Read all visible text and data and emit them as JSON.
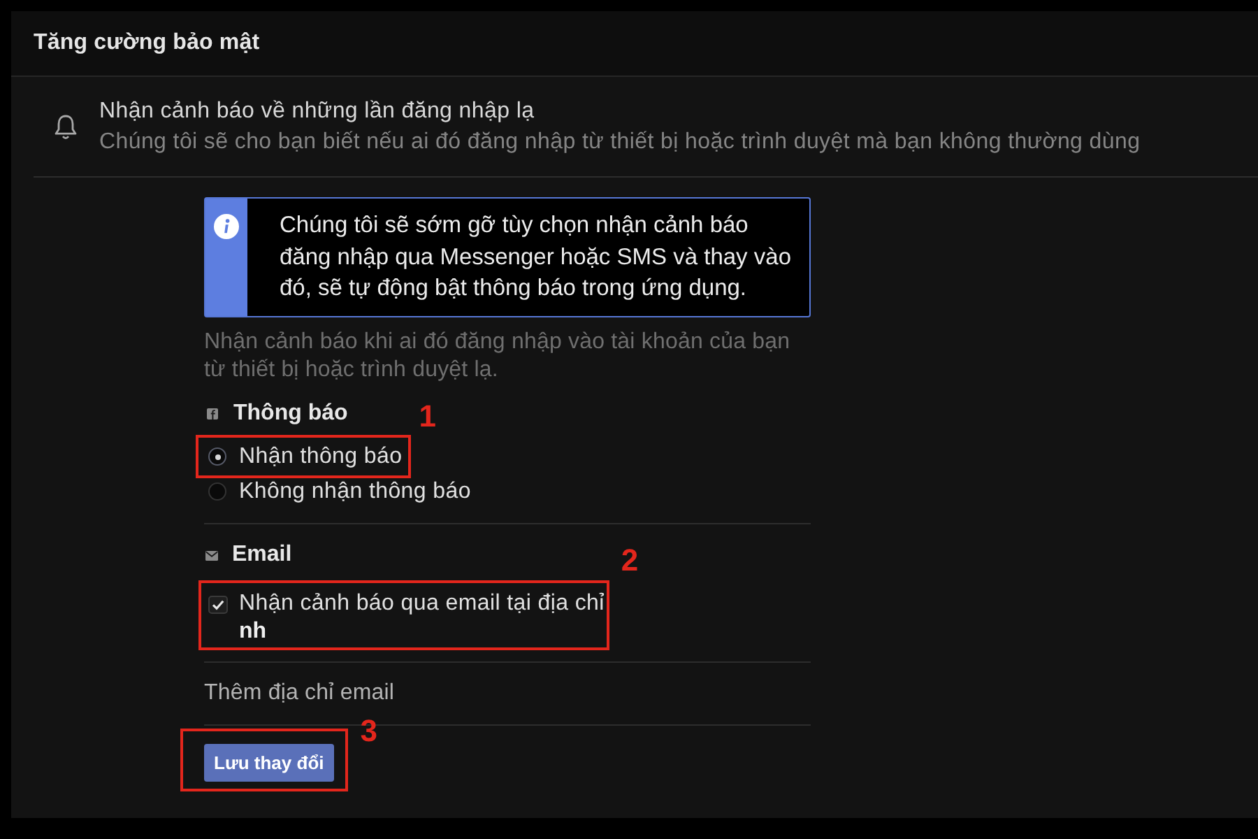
{
  "header": {
    "title": "Tăng cường bảo mật"
  },
  "alert_setting": {
    "title": "Nhận cảnh báo về những lần đăng nhập lạ",
    "description": "Chúng tôi sẽ cho bạn biết nếu ai đó đăng nhập từ thiết bị hoặc trình duyệt mà bạn không thường dùng"
  },
  "info_notice": {
    "text": "Chúng tôi sẽ sớm gỡ tùy chọn nhận cảnh báo đăng nhập qua Messenger hoặc SMS và thay vào đó, sẽ tự động bật thông báo trong ứng dụng."
  },
  "description": "Nhận cảnh báo khi ai đó đăng nhập vào tài khoản của bạn từ thiết bị hoặc trình duyệt lạ.",
  "sections": [
    {
      "kind": "radio",
      "heading": "Thông báo",
      "options": [
        {
          "label": "Nhận thông báo",
          "selected": true,
          "callout": "1"
        },
        {
          "label": "Không nhận thông báo",
          "selected": false
        }
      ]
    },
    {
      "kind": "checkbox",
      "heading": "Email",
      "options": [
        {
          "label": "Nhận cảnh báo qua email tại địa chỉ",
          "value": "nh",
          "checked": true,
          "callout": "2"
        }
      ]
    }
  ],
  "add_email_link": {
    "label": "Thêm địa chỉ email"
  },
  "save_button": {
    "label": "Lưu thay đổi",
    "callout": "3"
  }
}
